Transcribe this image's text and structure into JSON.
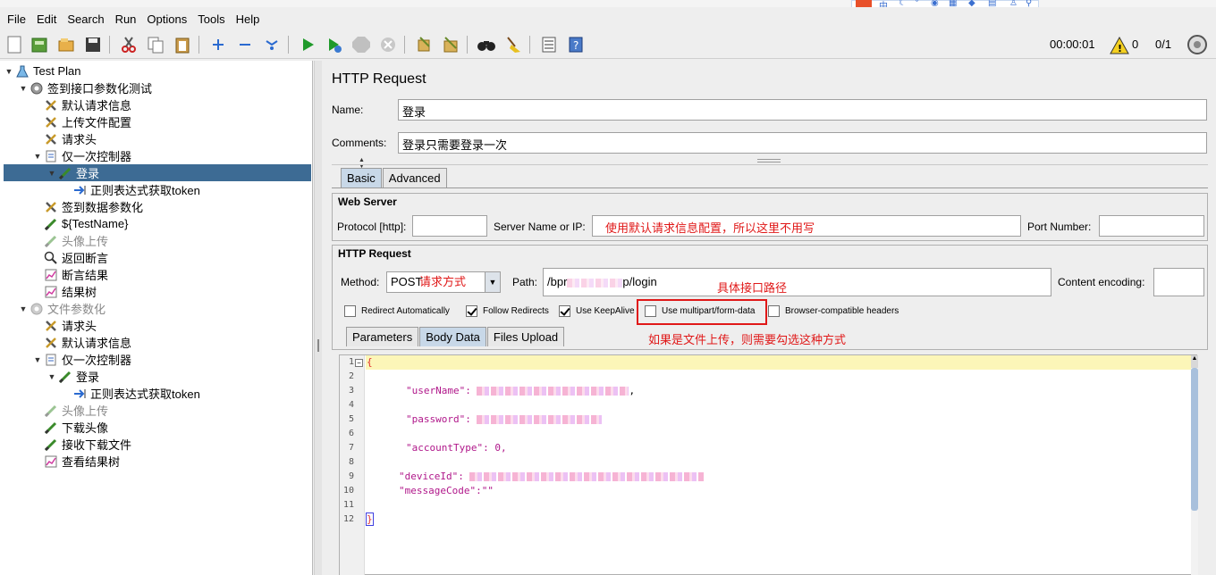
{
  "title_partial": "",
  "menu": [
    "File",
    "Edit",
    "Search",
    "Run",
    "Options",
    "Tools",
    "Help"
  ],
  "toolbar": {
    "elapsed": "00:00:01",
    "warnings": "0",
    "threads": "0/1"
  },
  "tree": [
    {
      "label": "Test Plan",
      "level": 0,
      "icon": "testplan-icon",
      "toggle": "▼"
    },
    {
      "label": "签到接口参数化测试",
      "level": 1,
      "icon": "gear-icon",
      "toggle": "▼"
    },
    {
      "label": "默认请求信息",
      "level": 2,
      "icon": "config-wrench-icon",
      "toggle": ""
    },
    {
      "label": "上传文件配置",
      "level": 2,
      "icon": "config-wrench-icon",
      "toggle": ""
    },
    {
      "label": "请求头",
      "level": 2,
      "icon": "config-wrench-icon",
      "toggle": ""
    },
    {
      "label": "仅一次控制器",
      "level": 2,
      "icon": "controller-icon",
      "toggle": "▼"
    },
    {
      "label": "登录",
      "level": 3,
      "icon": "sampler-pen-icon",
      "toggle": "▼",
      "selected": true
    },
    {
      "label": "正则表达式获取token",
      "level": 4,
      "icon": "extractor-icon",
      "toggle": ""
    },
    {
      "label": "签到数据参数化",
      "level": 2,
      "icon": "config-wrench-icon",
      "toggle": ""
    },
    {
      "label": "${TestName}",
      "level": 2,
      "icon": "sampler-pen-icon",
      "toggle": ""
    },
    {
      "label": "头像上传",
      "level": 2,
      "icon": "sampler-pen-icon",
      "toggle": "",
      "disabled": true
    },
    {
      "label": "返回断言",
      "level": 2,
      "icon": "magnifier-icon",
      "toggle": ""
    },
    {
      "label": "断言结果",
      "level": 2,
      "icon": "chart-icon",
      "toggle": ""
    },
    {
      "label": "结果树",
      "level": 2,
      "icon": "chart-icon",
      "toggle": ""
    },
    {
      "label": "文件参数化",
      "level": 1,
      "icon": "gear-icon",
      "toggle": "▼",
      "disabled": true
    },
    {
      "label": "请求头",
      "level": 2,
      "icon": "config-wrench-icon",
      "toggle": ""
    },
    {
      "label": "默认请求信息",
      "level": 2,
      "icon": "config-wrench-icon",
      "toggle": ""
    },
    {
      "label": "仅一次控制器",
      "level": 2,
      "icon": "controller-icon",
      "toggle": "▼"
    },
    {
      "label": "登录",
      "level": 3,
      "icon": "sampler-pen-icon",
      "toggle": "▼"
    },
    {
      "label": "正则表达式获取token",
      "level": 4,
      "icon": "extractor-icon",
      "toggle": ""
    },
    {
      "label": "头像上传",
      "level": 2,
      "icon": "sampler-pen-icon",
      "toggle": "",
      "disabled": true
    },
    {
      "label": "下载头像",
      "level": 2,
      "icon": "sampler-pen-icon",
      "toggle": ""
    },
    {
      "label": "接收下载文件",
      "level": 2,
      "icon": "sampler-pen-icon",
      "toggle": ""
    },
    {
      "label": "查看结果树",
      "level": 2,
      "icon": "chart-icon",
      "toggle": ""
    }
  ],
  "panel": {
    "title": "HTTP Request",
    "name_label": "Name:",
    "name_value": "登录",
    "comments_label": "Comments:",
    "comments_value": "登录只需要登录一次",
    "tabs": [
      "Basic",
      "Advanced"
    ],
    "web_server": {
      "title": "Web Server",
      "protocol_label": "Protocol [http]:",
      "protocol_value": "",
      "server_label": "Server Name or IP:",
      "server_note": "使用默认请求信息配置，所以这里不用写",
      "port_label": "Port Number:",
      "port_value": ""
    },
    "http_request": {
      "title": "HTTP Request",
      "method_label": "Method:",
      "method_value": "POST",
      "method_note": "请求方式",
      "path_label": "Path:",
      "path_prefix": "/bpr",
      "path_suffix": "p/login",
      "path_note": "具体接口路径",
      "encoding_label": "Content encoding:",
      "encoding_value": "",
      "checkboxes": [
        {
          "label": "Redirect Automatically",
          "checked": false
        },
        {
          "label": "Follow Redirects",
          "checked": true
        },
        {
          "label": "Use KeepAlive",
          "checked": true
        },
        {
          "label": "Use multipart/form-data",
          "checked": false
        },
        {
          "label": "Browser-compatible headers",
          "checked": false
        }
      ],
      "multipart_note": "如果是文件上传，则需要勾选这种方式",
      "subtabs": [
        "Parameters",
        "Body Data",
        "Files Upload"
      ]
    },
    "body": {
      "lines": [
        "1",
        "2",
        "3",
        "4",
        "5",
        "6",
        "7",
        "8",
        "9",
        "10",
        "11",
        "12"
      ],
      "open_brace": "{",
      "k_user": "\"userName\": ",
      "k_pass": "\"password\": ",
      "k_acct": "\"accountType\": 0,",
      "k_dev": "\"deviceId\": ",
      "k_msg": "\"messageCode\":\"\"",
      "close_brace": "}",
      "comma": ","
    }
  }
}
